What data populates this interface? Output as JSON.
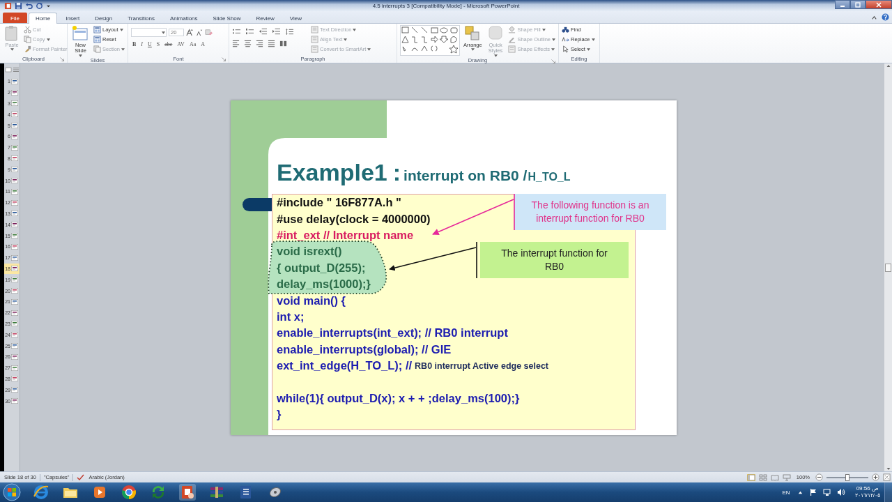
{
  "window": {
    "title": "4.5 interrupts 3 [Compatibility Mode] - Microsoft PowerPoint"
  },
  "tabs": [
    {
      "label": "File",
      "kind": "file",
      "selected": false
    },
    {
      "label": "Home",
      "kind": "tab",
      "selected": true
    },
    {
      "label": "Insert",
      "kind": "tab",
      "selected": false
    },
    {
      "label": "Design",
      "kind": "tab",
      "selected": false
    },
    {
      "label": "Transitions",
      "kind": "tab",
      "selected": false
    },
    {
      "label": "Animations",
      "kind": "tab",
      "selected": false
    },
    {
      "label": "Slide Show",
      "kind": "tab",
      "selected": false
    },
    {
      "label": "Review",
      "kind": "tab",
      "selected": false
    },
    {
      "label": "View",
      "kind": "tab",
      "selected": false
    }
  ],
  "ribbon": {
    "groups": [
      {
        "label": "Clipboard",
        "kind": "clipboard",
        "items": [
          {
            "label": "Paste",
            "kind": "large",
            "disabled": true,
            "dropdown": true
          },
          {
            "label": "Cut",
            "kind": "small",
            "disabled": true,
            "dropdown": false
          },
          {
            "label": "Copy",
            "kind": "small",
            "disabled": true,
            "dropdown": true
          },
          {
            "label": "Format Painter",
            "kind": "small",
            "disabled": true,
            "dropdown": false
          }
        ]
      },
      {
        "label": "Slides",
        "kind": "slides",
        "items": [
          {
            "label": "New Slide",
            "kind": "large",
            "disabled": false,
            "dropdown": true
          },
          {
            "label": "Layout",
            "kind": "small",
            "disabled": false,
            "dropdown": true
          },
          {
            "label": "Reset",
            "kind": "small",
            "disabled": false,
            "dropdown": false
          },
          {
            "label": "Section",
            "kind": "small",
            "disabled": true,
            "dropdown": true
          }
        ]
      },
      {
        "label": "Font",
        "kind": "font",
        "font_size": "20",
        "buttons": [
          {
            "label": "B"
          },
          {
            "label": "I"
          },
          {
            "label": "U"
          },
          {
            "label": "S"
          },
          {
            "label": "abe"
          },
          {
            "label": "AV"
          },
          {
            "label": "Aa"
          },
          {
            "label": "A"
          }
        ]
      },
      {
        "label": "Paragraph",
        "kind": "paragraph",
        "items": [
          {
            "label": "Text Direction",
            "kind": "small",
            "disabled": true,
            "dropdown": true
          },
          {
            "label": "Align Text",
            "kind": "small",
            "disabled": true,
            "dropdown": true
          },
          {
            "label": "Convert to SmartArt",
            "kind": "small",
            "disabled": true,
            "dropdown": true
          }
        ]
      },
      {
        "label": "Drawing",
        "kind": "drawing",
        "items": [
          {
            "label": "Arrange",
            "kind": "large",
            "disabled": false,
            "dropdown": true
          },
          {
            "label": "Quick Styles",
            "kind": "large",
            "disabled": true,
            "dropdown": true
          },
          {
            "label": "Shape Fill",
            "kind": "small",
            "disabled": true,
            "dropdown": true
          },
          {
            "label": "Shape Outline",
            "kind": "small",
            "disabled": true,
            "dropdown": true
          },
          {
            "label": "Shape Effects",
            "kind": "small",
            "disabled": true,
            "dropdown": true
          }
        ]
      },
      {
        "label": "Editing",
        "kind": "editing",
        "items": [
          {
            "label": "Find",
            "kind": "small",
            "disabled": false,
            "dropdown": false
          },
          {
            "label": "Replace",
            "kind": "small",
            "disabled": false,
            "dropdown": true
          },
          {
            "label": "Select",
            "kind": "small",
            "disabled": false,
            "dropdown": true
          }
        ]
      }
    ]
  },
  "slide_thumbnails": [
    {
      "number": "1",
      "selected": false
    },
    {
      "number": "2",
      "selected": false
    },
    {
      "number": "3",
      "selected": false
    },
    {
      "number": "4",
      "selected": false
    },
    {
      "number": "5",
      "selected": false
    },
    {
      "number": "6",
      "selected": false
    },
    {
      "number": "7",
      "selected": false
    },
    {
      "number": "8",
      "selected": false
    },
    {
      "number": "9",
      "selected": false
    },
    {
      "number": "10",
      "selected": false
    },
    {
      "number": "11",
      "selected": false
    },
    {
      "number": "12",
      "selected": false
    },
    {
      "number": "13",
      "selected": false
    },
    {
      "number": "14",
      "selected": false
    },
    {
      "number": "15",
      "selected": false
    },
    {
      "number": "16",
      "selected": false
    },
    {
      "number": "17",
      "selected": false
    },
    {
      "number": "18",
      "selected": true
    },
    {
      "number": "19",
      "selected": false
    },
    {
      "number": "20",
      "selected": false
    },
    {
      "number": "21",
      "selected": false
    },
    {
      "number": "22",
      "selected": false
    },
    {
      "number": "23",
      "selected": false
    },
    {
      "number": "24",
      "selected": false
    },
    {
      "number": "25",
      "selected": false
    },
    {
      "number": "26",
      "selected": false
    },
    {
      "number": "27",
      "selected": false
    },
    {
      "number": "28",
      "selected": false
    },
    {
      "number": "29",
      "selected": false
    },
    {
      "number": "30",
      "selected": false
    }
  ],
  "slide": {
    "title": [
      {
        "text": "Example1",
        "kind": "large"
      },
      {
        "text": ":",
        "kind": "large"
      },
      {
        "text": "interrupt on RB0 /",
        "kind": "medium"
      },
      {
        "text": "H_TO_L",
        "kind": "small"
      }
    ],
    "code_lines": [
      {
        "text": "#include \" 16F877A.h \"",
        "color": "#111111",
        "highlighted": false,
        "gap_before": false
      },
      {
        "text": "#use delay(clock = 4000000)",
        "color": "#111111",
        "highlighted": false,
        "gap_before": false
      },
      {
        "text": "#int_ext // Interrupt name",
        "color": "#d81b60",
        "highlighted": false,
        "gap_before": false
      },
      {
        "text": "void isrext()",
        "color": "#2a6b48",
        "highlighted": true,
        "gap_before": false
      },
      {
        "text": "{ output_D(255);",
        "color": "#2a6b48",
        "highlighted": true,
        "gap_before": false
      },
      {
        "text": "delay_ms(1000);}",
        "color": "#2a6b48",
        "highlighted": true,
        "gap_before": false
      },
      {
        "text": "void main() {",
        "color": "#1c1cb0",
        "highlighted": false,
        "gap_before": false
      },
      {
        "text": "int x;",
        "color": "#1c1cb0",
        "highlighted": false,
        "gap_before": false
      },
      {
        "text": "enable_interrupts(int_ext); // RB0 interrupt",
        "color": "#1c1cb0",
        "highlighted": false,
        "gap_before": false
      },
      {
        "text": "enable_interrupts(global); // GIE",
        "color": "#1c1cb0",
        "highlighted": false,
        "gap_before": false
      },
      {
        "text": "ext_int_edge(H_TO_L); //",
        "comment": "RB0 interrupt Active edge select",
        "color": "#1c1cb0",
        "highlighted": false,
        "gap_before": false
      },
      {
        "text": "while(1){ output_D(x); x + + ;delay_ms(100);}",
        "color": "#1c1cb0",
        "highlighted": false,
        "gap_before": true
      },
      {
        "text": "}",
        "color": "#1c1cb0",
        "highlighted": false,
        "gap_before": false
      }
    ],
    "callouts": [
      {
        "text": "The following function is an interrupt function for RB0",
        "color": "#cfe6f8"
      },
      {
        "text": "The interrupt function for RB0",
        "color": "#c3f290"
      }
    ]
  },
  "status_bar": {
    "slide": "Slide 18 of 30",
    "theme": "\"Capsules\"",
    "language": "Arabic (Jordan)",
    "zoom": "100%",
    "zoom_level": {
      "level": 0.5
    }
  },
  "taskbar": {
    "language": "EN",
    "time": "09:56 ص",
    "date": "٢٠١٦/١٢/٠٥"
  }
}
